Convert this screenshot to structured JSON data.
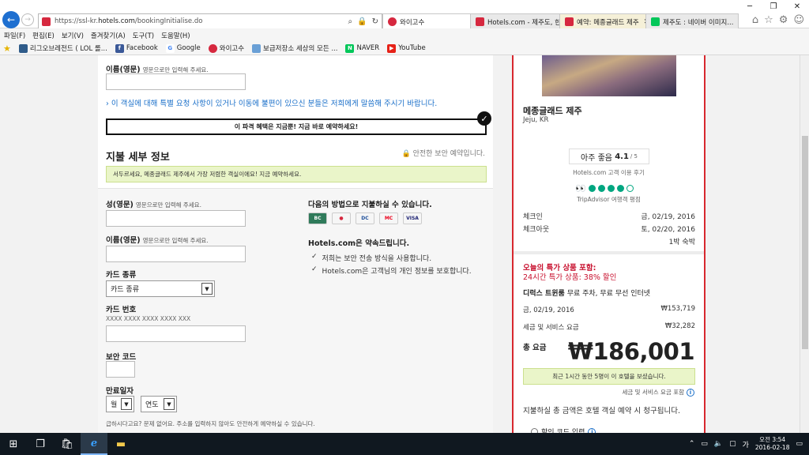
{
  "browser": {
    "url_prefix": "https://ssl-kr.",
    "url_host": "hotels.com",
    "url_path": "/bookingInitialise.do",
    "addr_tab": "와이고수",
    "tabs": [
      {
        "label": "Hotels.com - 제주도, 한...",
        "color": "#d6283f",
        "active": false
      },
      {
        "label": "예약: 메종글래드 제주",
        "color": "#d6283f",
        "active": true
      },
      {
        "label": "제주도 : 네이버 이미지...",
        "color": "#03c75a",
        "active": false
      }
    ],
    "menu": [
      "파일(F)",
      "편집(E)",
      "보기(V)",
      "즐겨찾기(A)",
      "도구(T)",
      "도움말(H)"
    ],
    "favorites": [
      {
        "label": "리그오브레전드 ( LOL 롤...",
        "color": "#2f5c8a"
      },
      {
        "label": "Facebook",
        "color": "#3b5998",
        "glyph": "f"
      },
      {
        "label": "Google",
        "color": "#4285f4",
        "glyph": "G"
      },
      {
        "label": "와이고수",
        "color": "#d6283f"
      },
      {
        "label": "보급저장소  세상의 모든 ...",
        "color": "#6aa0d6"
      },
      {
        "label": "NAVER",
        "color": "#03c75a",
        "glyph": "N"
      },
      {
        "label": "YouTube",
        "color": "#e62117",
        "glyph": "▶"
      }
    ]
  },
  "form": {
    "first_name_label": "이름(영문)",
    "first_name_hint": "영문으로만 입력해 주세요.",
    "special_request": "이 객실에 대해 특별 요청 사항이 있거나 이동에 불편이 있으신 분들은 저희에게 말씀해 주시기 바랍니다.",
    "promo_banner": "이 파격 혜택은 지금뿐! 지금 바로 예약하세요!",
    "payment_title": "지불 세부 정보",
    "secure_note": "안전한 보안 예약입니다.",
    "urgency_alert": "서두르세요, 메종글래드 제주에서 가장 저렴한 객실이에요! 지금 예약하세요.",
    "last_name_label": "성(영문)",
    "last_name_hint": "영문으로만 입력해 주세요.",
    "first_name2_label": "이름(영문)",
    "first_name2_hint": "영문으로만 입력해 주세요.",
    "card_type_label": "카드 종류",
    "card_type_value": "카드 종류",
    "card_number_label": "카드 번호",
    "card_number_placeholder": "XXXX XXXX XXXX XXXX XXX",
    "security_code_label": "보안 코드",
    "expiry_label": "만료일자",
    "month_value": "월",
    "year_value": "연도",
    "footer_note": "급하시다고요? 문제 없어요. 주소를 입력하지 않아도 안전하게 예약하실 수 있습니다.",
    "pay_methods_title": "다음의 방법으로 지불하실 수 있습니다.",
    "cards": [
      {
        "label": "BC",
        "bg": "#2f7a5a",
        "fg": "#fff"
      },
      {
        "label": "●",
        "bg": "#fff",
        "fg": "#d6283f"
      },
      {
        "label": "DC",
        "bg": "#fff",
        "fg": "#1e4f9a"
      },
      {
        "label": "MC",
        "bg": "#fff",
        "fg": "#eb001b"
      },
      {
        "label": "VISA",
        "bg": "#fff",
        "fg": "#1a1f71"
      }
    ],
    "promise_title": "Hotels.com은 약속드립니다.",
    "promises": [
      "저희는 보안 전송 방식을 사용합니다.",
      "Hotels.com은 고객님의 개인 정보를 보호합니다."
    ]
  },
  "summary": {
    "hotel_name": "메종글래드 제주",
    "hotel_location": "Jeju, KR",
    "rating_text": "아주 좋음",
    "rating_value": "4.1",
    "rating_outof": "/ 5",
    "rating_source": "Hotels.com 고객 이용 후기",
    "ta_score_circles": 4,
    "ta_label": "TripAdvisor 여행객 평점",
    "checkin_label": "체크인",
    "checkin_value": "금, 02/19, 2016",
    "checkout_label": "체크아웃",
    "checkout_value": "토, 02/20, 2016",
    "nights": "1박 숙박",
    "deal_line1": "오늘의 특가 상품 포함:",
    "deal_line2": "24시간 특가 상품: 38% 할인",
    "room_name": "디럭스 트윈룸",
    "room_features": "무료 주차, 무료 무선 인터넷",
    "night_date": "금, 02/19, 2016",
    "night_price": "₩153,719",
    "tax_label": "세금 및 서비스 요금",
    "tax_value": "₩32,282",
    "total_label": "총 요금",
    "total_value": "₩186,001",
    "viewers_note": "최근 1시간 동안 5명이 이 호텔을 보셨습니다.",
    "tax_included": "세금 및 서비스 요금 포함",
    "charge_note": "지불하실 총 금액은 호텔 객실 예약 시 청구됩니다.",
    "coupon_label": "할인 코드 입력"
  },
  "taskbar": {
    "ime": "가",
    "time": "오전 3:54",
    "date": "2016-02-18"
  }
}
